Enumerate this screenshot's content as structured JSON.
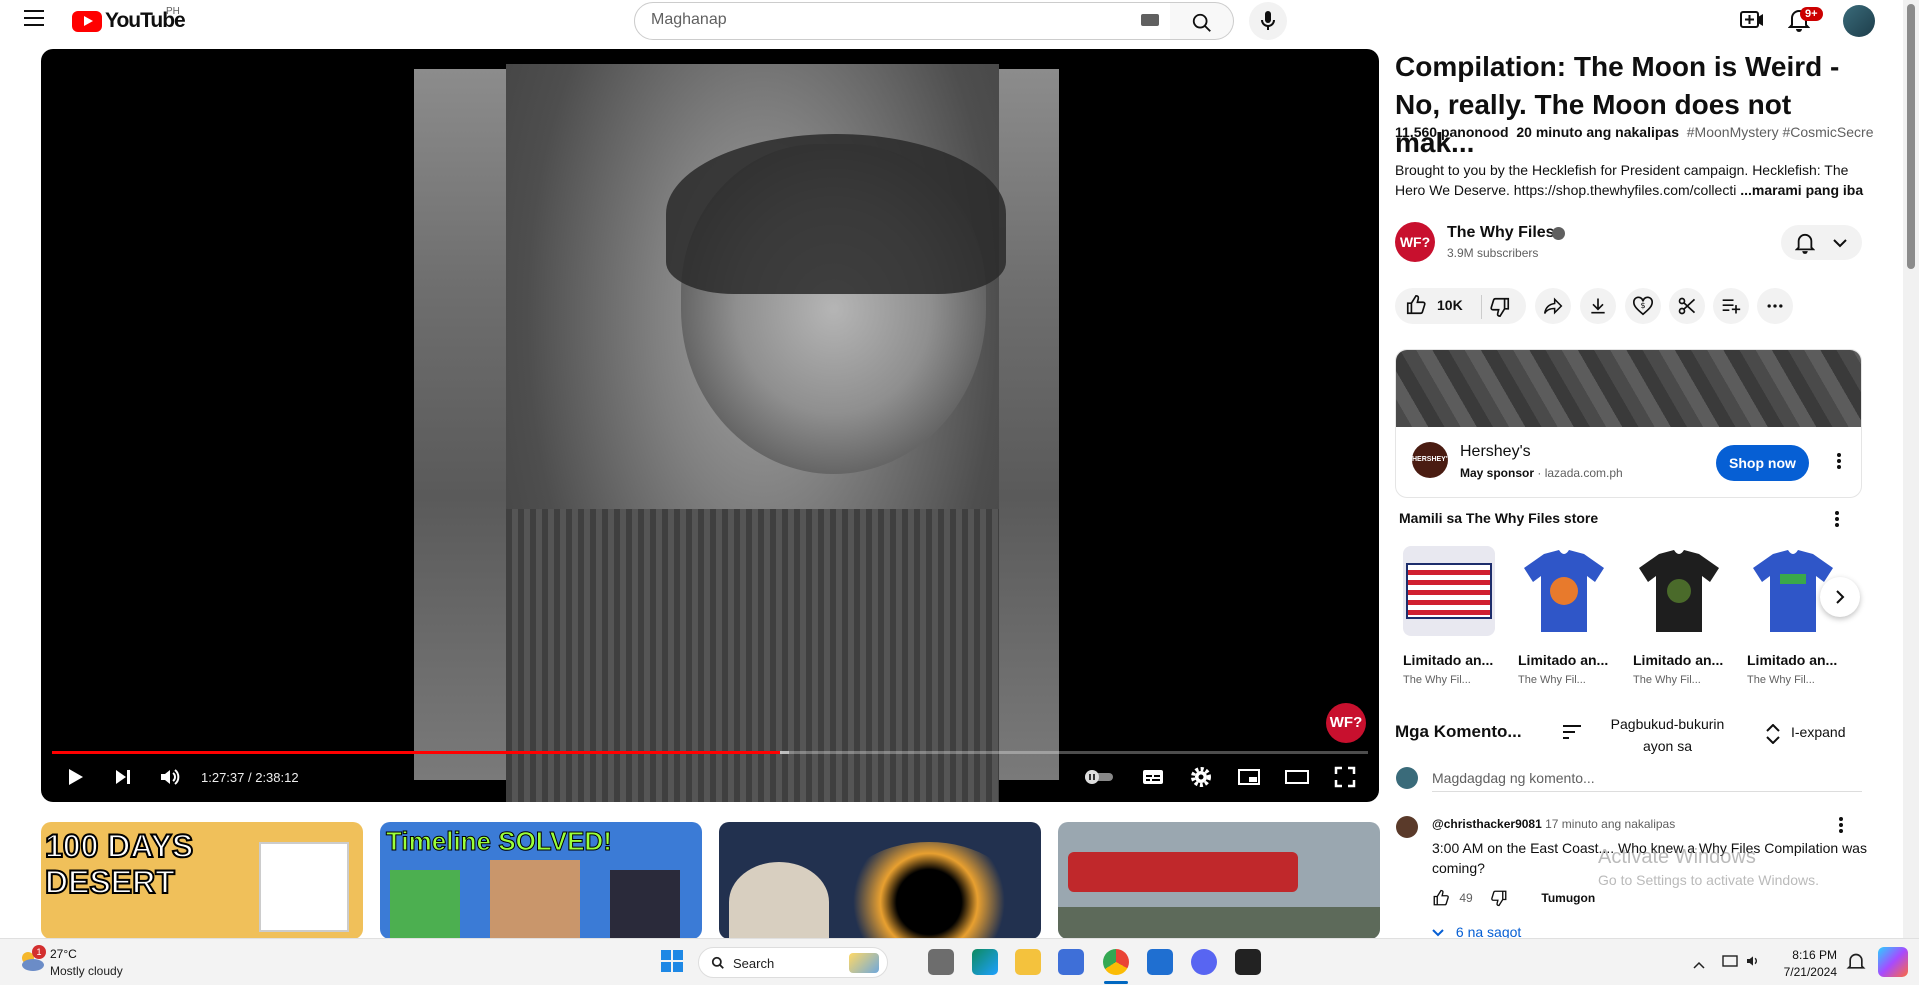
{
  "header": {
    "logo_text": "YouTube",
    "country_code": "PH",
    "search_placeholder": "Maghanap",
    "notifications_badge": "9+"
  },
  "player": {
    "time_display": "1:27:37 / 2:38:12",
    "progress_fraction": 0.553,
    "buffered_fraction": 0.56,
    "watermark_text": "WF?"
  },
  "video": {
    "title": "Compilation: The Moon is Weird - No, really. The Moon does not mak...",
    "views": "11,560 panonood",
    "uploaded": "20 minuto ang nakalipas",
    "tags": "#MoonMystery #CosmicSecre",
    "description": "Brought to you by the Hecklefish for President campaign. Hecklefish: The Hero We Deserve. https://shop.thewhyfiles.com/collecti",
    "more_label": "...marami pang iba"
  },
  "channel": {
    "avatar_text": "WF?",
    "name": "The Why Files",
    "subscribers": "3.9M subscribers"
  },
  "actions": {
    "like_count": "10K"
  },
  "ad": {
    "logo_text": "HERSHEY'S",
    "title": "Hershey's",
    "sponsor_label": "May sponsor",
    "domain": "lazada.com.ph",
    "cta": "Shop now"
  },
  "store": {
    "title": "Mamili sa The Why Files store",
    "items": [
      {
        "label": "Limitado an...",
        "seller": "The Why Fil...",
        "color": "#e8e8f0"
      },
      {
        "label": "Limitado an...",
        "seller": "The Why Fil...",
        "color": "#2f56c8"
      },
      {
        "label": "Limitado an...",
        "seller": "The Why Fil...",
        "color": "#1e1e1e"
      },
      {
        "label": "Limitado an...",
        "seller": "The Why Fil...",
        "color": "#2f56c8"
      }
    ]
  },
  "comments": {
    "title": "Mga Komento...",
    "sort_label": "Pagbukud-bukurin ayon sa",
    "expand_label": "I-expand",
    "input_placeholder": "Magdagdag ng komento...",
    "first": {
      "author": "@christhacker9081",
      "time": "17 minuto ang nakalipas",
      "text": "3:00 AM on the East Coast....  Who knew a Why Files Compilation was coming?",
      "likes": "49",
      "reply_label": "Tumugon",
      "replies": "6 na sagot"
    }
  },
  "watermark": {
    "line1": "Activate Windows",
    "line2": "Go to Settings to activate Windows."
  },
  "recommendations": [
    {
      "title_text": "100 DAYS DESERT",
      "bg": "#f0c05a"
    },
    {
      "title_text": "Timeline SOLVED!",
      "bg": "#3b7bd6"
    },
    {
      "title_text": "",
      "bg": "#22314f"
    },
    {
      "title_text": "",
      "bg": "#9aa7b0"
    }
  ],
  "taskbar": {
    "weather_badge": "1",
    "temperature": "27°C",
    "weather": "Mostly cloudy",
    "search_label": "Search",
    "time": "8:16 PM",
    "date": "7/21/2024"
  },
  "colors": {
    "accent_red": "#ff0000",
    "link_blue": "#065fd4",
    "brand_wf": "#c8102e"
  }
}
